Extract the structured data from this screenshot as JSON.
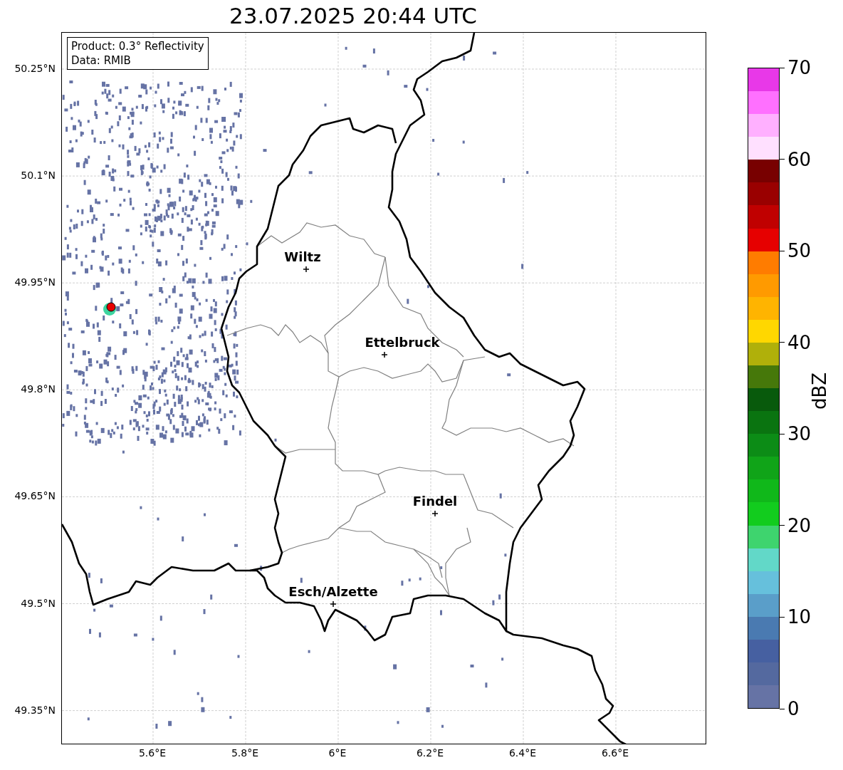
{
  "title": "23.07.2025 20:44 UTC",
  "info_box": {
    "product": "Product: 0.3° Reflectivity",
    "data": "Data: RMIB"
  },
  "cities": [
    {
      "name": "Wiltz"
    },
    {
      "name": "Ettelbruck"
    },
    {
      "name": "Findel"
    },
    {
      "name": "Esch/Alzette"
    }
  ],
  "x_ticks": [
    "5.6°E",
    "5.8°E",
    "6°E",
    "6.2°E",
    "6.4°E",
    "6.6°E"
  ],
  "y_ticks": [
    "50.25°N",
    "50.1°N",
    "49.95°N",
    "49.8°N",
    "49.65°N",
    "49.5°N",
    "49.35°N"
  ],
  "colorbar": {
    "label": "dBZ",
    "ticks": [
      "70",
      "60",
      "50",
      "40",
      "30",
      "20",
      "10",
      "0"
    ],
    "segments": [
      {
        "color": "#e838e8"
      },
      {
        "color": "#ff70ff"
      },
      {
        "color": "#ffb0ff"
      },
      {
        "color": "#ffe0ff"
      },
      {
        "color": "#780000"
      },
      {
        "color": "#9a0000"
      },
      {
        "color": "#c00000"
      },
      {
        "color": "#e60000"
      },
      {
        "color": "#ff7c00"
      },
      {
        "color": "#ff9a00"
      },
      {
        "color": "#ffb400"
      },
      {
        "color": "#ffd700"
      },
      {
        "color": "#b0b00a"
      },
      {
        "color": "#46780a"
      },
      {
        "color": "#085a0c"
      },
      {
        "color": "#0a7410"
      },
      {
        "color": "#0c8c16"
      },
      {
        "color": "#10a418"
      },
      {
        "color": "#10b81a"
      },
      {
        "color": "#12cc1e"
      },
      {
        "color": "#3ed46e"
      },
      {
        "color": "#62d8c8"
      },
      {
        "color": "#66c0dc"
      },
      {
        "color": "#5a9ec9"
      },
      {
        "color": "#4a7ab1"
      },
      {
        "color": "#4660a1"
      },
      {
        "color": "#54699f"
      },
      {
        "color": "#6673a5"
      }
    ]
  }
}
